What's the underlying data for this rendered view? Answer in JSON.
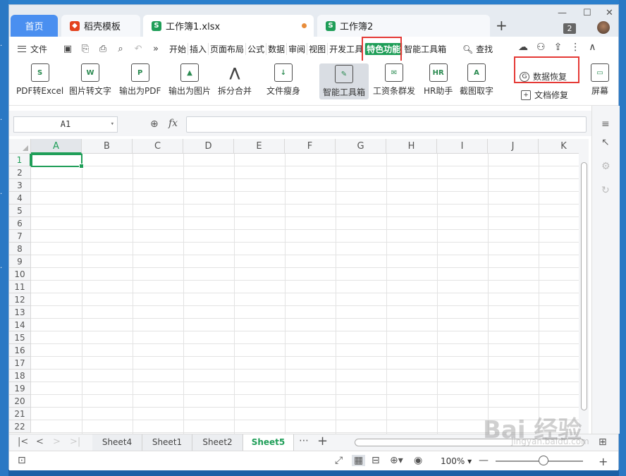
{
  "tabs": {
    "home": "首页",
    "docer": "稻壳模板",
    "book1": "工作簿1.xlsx",
    "book2": "工作簿2",
    "window_count": "2"
  },
  "menu": {
    "file": "文件",
    "tabs": [
      "开始",
      "插入",
      "页面布局",
      "公式",
      "数据",
      "审阅",
      "视图",
      "开发工具",
      "特色功能",
      "智能工具箱"
    ],
    "active_tab": "特色功能",
    "search": "查找"
  },
  "ribbon": {
    "buttons": [
      "PDF转Excel",
      "图片转文字",
      "输出为PDF",
      "输出为图片",
      "拆分合并",
      "文件瘦身",
      "智能工具箱",
      "工资条群发",
      "HR助手",
      "截图取字",
      "屏幕"
    ],
    "selected": "智能工具箱",
    "data_recovery": "数据恢复",
    "doc_repair": "文档修复"
  },
  "formula": {
    "cell_ref": "A1",
    "fx": "fx",
    "value": ""
  },
  "grid": {
    "columns": [
      "A",
      "B",
      "C",
      "D",
      "E",
      "F",
      "G",
      "H",
      "I",
      "J",
      "K"
    ],
    "rows": [
      "1",
      "2",
      "3",
      "4",
      "5",
      "6",
      "7",
      "8",
      "9",
      "10",
      "11",
      "12",
      "13",
      "14",
      "15",
      "16",
      "17",
      "18",
      "19",
      "20",
      "21",
      "22"
    ],
    "active_cell": "A1"
  },
  "sheets": {
    "tabs": [
      "Sheet4",
      "Sheet1",
      "Sheet2",
      "Sheet5"
    ],
    "active": "Sheet5"
  },
  "status": {
    "zoom": "100%"
  },
  "watermark": {
    "main": "Bai 经验",
    "sub": "jingyan.baidu.com"
  },
  "colors": {
    "accent": "#1f9e58",
    "home_tab": "#4a8ff0",
    "highlight": "#e53935"
  }
}
